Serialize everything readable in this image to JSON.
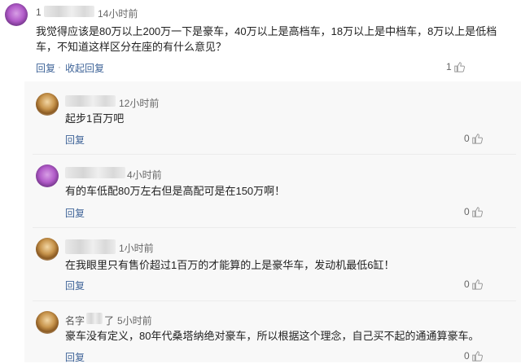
{
  "top": {
    "username": "1",
    "time": "14小时前",
    "text_line1": "我觉得应该是80万以上200万一下是豪车，40万以上是高档车，18万以上是中档车，8万以上是低档",
    "text_line2": "车，不知道这样区分在座的有什么意见？",
    "reply": "回复",
    "collapse": "收起回复",
    "separator": "·",
    "likes": "1"
  },
  "replies": [
    {
      "username": "",
      "time": "12小时前",
      "text": "起步1百万吧",
      "reply": "回复",
      "likes": "0"
    },
    {
      "username": "",
      "time": "4小时前",
      "text": "有的车低配80万左右但是高配可是在150万啊！",
      "reply": "回复",
      "likes": "0"
    },
    {
      "username": "",
      "time": "1小时前",
      "text": "在我眼里只有售价超过1百万的才能算的上是豪华车，发动机最低6缸！",
      "reply": "回复",
      "likes": "0"
    },
    {
      "username": "名字",
      "username_suffix": "了",
      "time": "5小时前",
      "text": "豪车没有定义，80年代桑塔纳绝对豪车，所以根据这个理念，自己买不起的通通算豪车。",
      "reply": "回复",
      "likes": "0"
    }
  ],
  "colors": {
    "link": "#406599",
    "reply_bg": "#f8f8f8"
  },
  "icons": {
    "like": "thumbs-up-icon",
    "avatar": "user-avatar"
  }
}
